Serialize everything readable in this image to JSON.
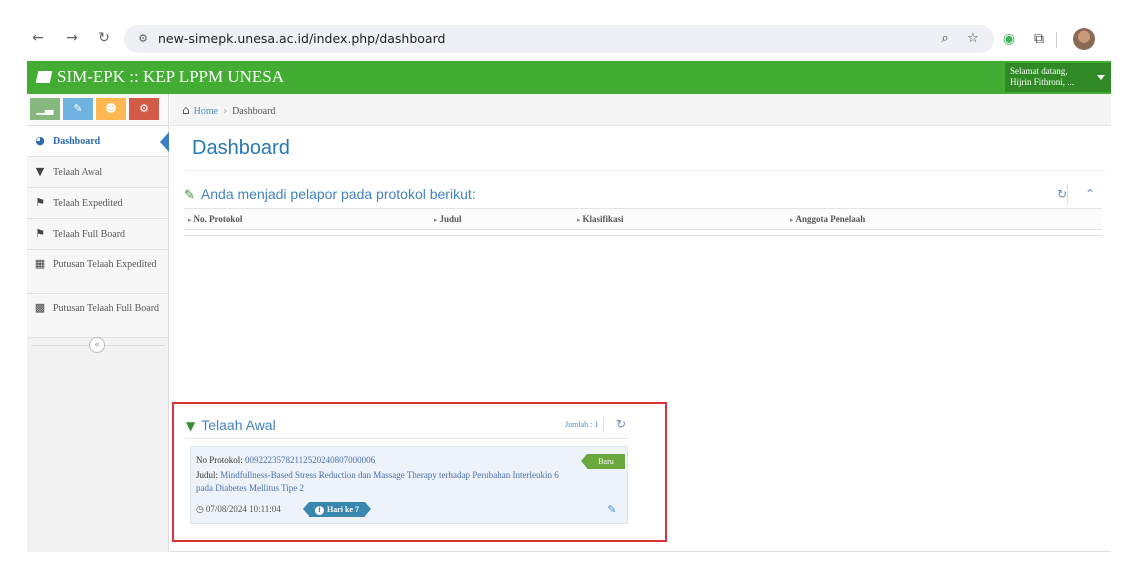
{
  "browser": {
    "url": "new-simepk.unesa.ac.id/index.php/dashboard",
    "icons": {
      "back": "back-arrow-icon",
      "forward": "forward-arrow-icon",
      "reload": "reload-icon",
      "site_settings": "site-settings-icon",
      "zoom": "zoom-icon",
      "bookmark": "star-icon",
      "extension": "eye-extension-icon",
      "extensions_menu": "puzzle-icon",
      "profile": "profile-avatar"
    }
  },
  "header": {
    "brand": "SIM-EPK :: KEP LPPM UNESA",
    "user_greeting": "Selamat datang,",
    "user_name": "Hijrin Fithroni, ...",
    "color": "#43ad33"
  },
  "sidebar": {
    "items": [
      {
        "label": "Dashboard",
        "icon": "dashboard-icon",
        "active": true
      },
      {
        "label": "Telaah Awal",
        "icon": "filter-icon",
        "active": false
      },
      {
        "label": "Telaah Expedited",
        "icon": "flag-icon",
        "active": false
      },
      {
        "label": "Telaah Full Board",
        "icon": "flag-icon",
        "active": false
      },
      {
        "label": "Putusan Telaah Expedited",
        "icon": "grid-icon",
        "active": false
      },
      {
        "label": "Putusan Telaah Full Board",
        "icon": "grid-dense-icon",
        "active": false
      }
    ]
  },
  "breadcrumb": {
    "home": "Home",
    "current": "Dashboard"
  },
  "main": {
    "title": "Dashboard",
    "pelapor_widget": {
      "title": "Anda menjadi pelapor pada protokol berikut:",
      "columns": [
        "No. Protokol",
        "Judul",
        "Klasifikasi",
        "Anggota Penelaah"
      ]
    },
    "telaah_awal": {
      "title": "Telaah Awal",
      "count_label": "Jumlah : 1",
      "item": {
        "protocol_label": "No Protokol:",
        "protocol_number": "00922235782112520240807000006",
        "judul_label": "Judul:",
        "judul": "Mindfullness-Based Stress Reduction dan Massage Therapy terhadap Perubahan Interleukin 6 pada Diabetes Mellitus Tipe 2",
        "badge": "Baru",
        "timestamp": "07/08/2024 10:11:04",
        "day_label": "Hari ke 7"
      }
    }
  }
}
